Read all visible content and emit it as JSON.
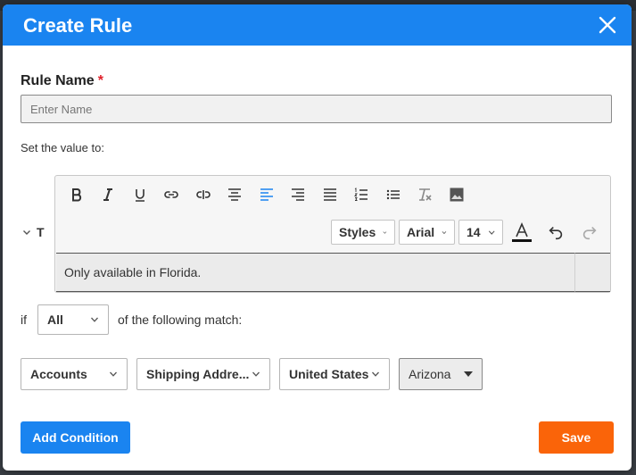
{
  "modal": {
    "title": "Create Rule"
  },
  "rule_name": {
    "label": "Rule Name",
    "required_mark": "*",
    "placeholder": "Enter Name",
    "value": ""
  },
  "set_value": {
    "label": "Set the value to:",
    "type_label": "T"
  },
  "editor": {
    "toolbar_row1": [
      "bold-icon",
      "italic-icon",
      "underline-icon",
      "link-icon",
      "unlink-icon",
      "align-center-icon",
      "align-left-icon",
      "align-right-icon",
      "align-justify-icon",
      "ordered-list-icon",
      "unordered-list-icon",
      "clear-format-icon",
      "image-icon"
    ],
    "styles_label": "Styles",
    "font_family": "Arial",
    "font_size": "14",
    "content": "Only available in Florida.",
    "active_color": "#1a84f0"
  },
  "match": {
    "if_label": "if",
    "selected": "All",
    "suffix": "of the following match:"
  },
  "condition": {
    "field1": "Accounts",
    "field2": "Shipping Addre...",
    "field3": "United States",
    "field4": "Arizona"
  },
  "buttons": {
    "add_condition": "Add Condition",
    "save": "Save"
  },
  "colors": {
    "primary": "#1a84f0",
    "save": "#fa6409",
    "required": "#e0202a"
  }
}
